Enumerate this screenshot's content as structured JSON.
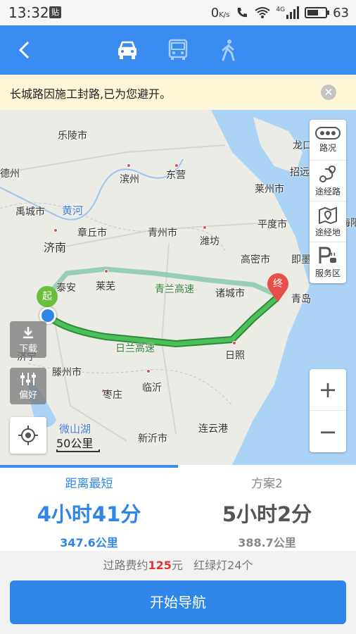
{
  "status_bar": {
    "time": "13:32",
    "notification_badge": "贴",
    "net_speed": "0",
    "net_speed_unit": "K/s",
    "signal_label": "4G",
    "battery": "63"
  },
  "header": {
    "modes": [
      {
        "icon": "car-icon",
        "active": true
      },
      {
        "icon": "bus-icon",
        "active": false
      },
      {
        "icon": "walk-icon",
        "active": false
      }
    ]
  },
  "notice": {
    "text": "长城路因施工封路,已为您避开。"
  },
  "map": {
    "labels": {
      "leling": "乐陵市",
      "dezhou": "德州",
      "binzhou": "滨州",
      "dongying": "东营",
      "longkou": "龙口",
      "zhaoyuan": "招远",
      "laizhou": "莱州市",
      "yucheng": "禹城市",
      "huanghe": "黄河",
      "zhangqiu": "章丘市",
      "qingzhou": "青州市",
      "weifang": "潍坊",
      "pingdu": "平度市",
      "jinan": "济南",
      "gaomi": "高密市",
      "jimo": "即墨",
      "haiyang": "海阳",
      "taian": "泰安",
      "laiwu": "莱芜",
      "qingdao": "青岛",
      "zhucheng": "诸城市",
      "qinglan_highway": "青兰高速",
      "rilan_highway": "日兰高速",
      "rizhao": "日照",
      "jining": "济宁",
      "tengzhou": "滕州市",
      "zaozhuang": "枣庄",
      "linyi": "临沂",
      "weishanhu": "微山湖",
      "lianyungang": "连云港",
      "xinyi": "新沂市"
    },
    "start_marker": "起",
    "end_marker": "终",
    "tools": [
      {
        "label": "路况",
        "icon": "traffic-icon"
      },
      {
        "label": "途经路",
        "icon": "via-road-icon"
      },
      {
        "label": "途经地",
        "icon": "via-place-icon"
      },
      {
        "label": "服务区",
        "icon": "parking-icon"
      }
    ],
    "download_label": "下载",
    "preference_label": "偏好",
    "scale_label": "50公里",
    "zoom_in": "+",
    "zoom_out": "−"
  },
  "routes": [
    {
      "name": "距离最短",
      "duration": "4小时41分",
      "distance": "347.6公里",
      "selected": true
    },
    {
      "name": "方案2",
      "duration": "5小时2分",
      "distance": "388.7公里",
      "selected": false
    }
  ],
  "route_info": {
    "toll_prefix": "过路费约",
    "toll_value": "125",
    "toll_suffix": "元",
    "lights": "红绿灯24个"
  },
  "start_button": "开始导航",
  "colors": {
    "accent": "#3b8cf0",
    "route": "#39b54a",
    "toll": "#e3332c"
  }
}
